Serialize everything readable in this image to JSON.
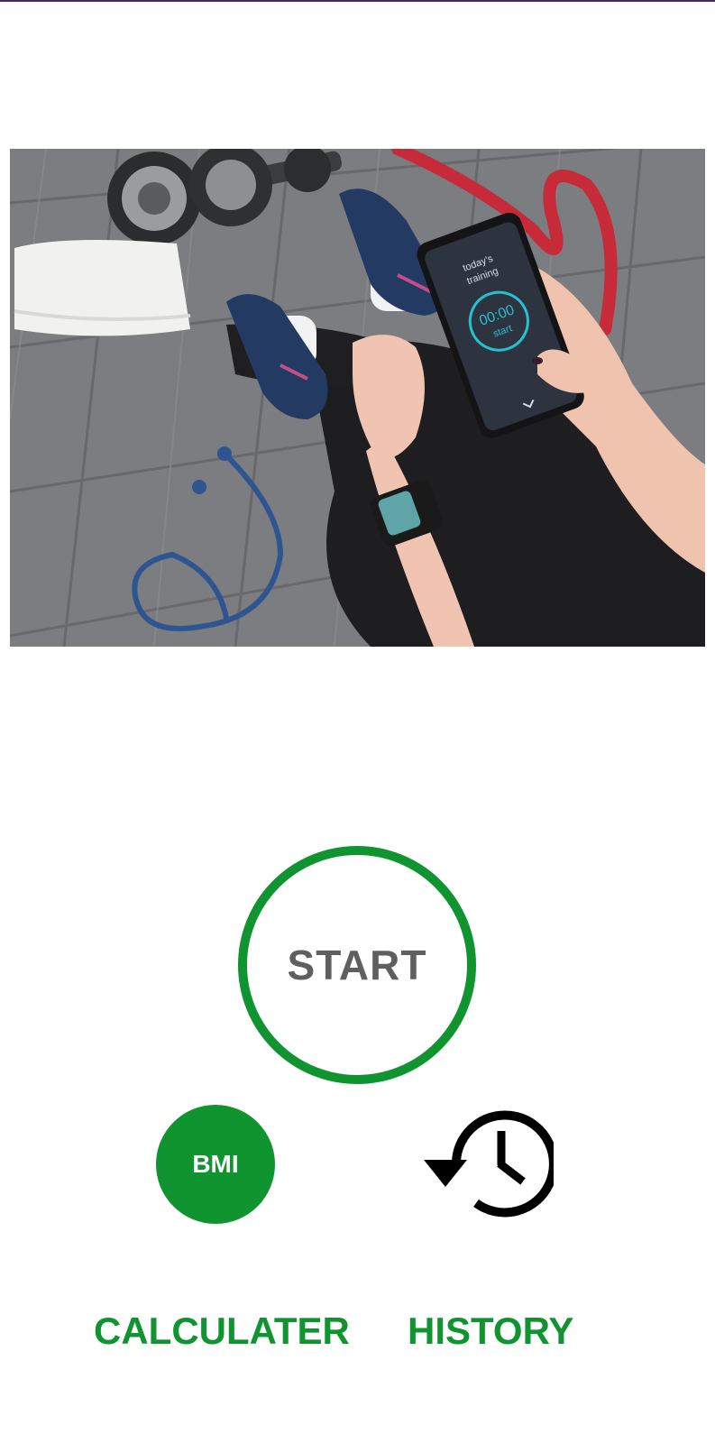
{
  "hero": {
    "phone_screen": {
      "heading_line1": "today's",
      "heading_line2": "training",
      "timer": "00:00",
      "action": "start"
    }
  },
  "main": {
    "start_label": "START"
  },
  "shortcuts": {
    "bmi_label": "BMI",
    "bmi_caption": "CALCULATER",
    "history_icon": "history-icon",
    "history_caption": "HISTORY"
  },
  "colors": {
    "accent": "#0f9430",
    "start_text": "#5f5f5f",
    "icon": "#000000"
  }
}
